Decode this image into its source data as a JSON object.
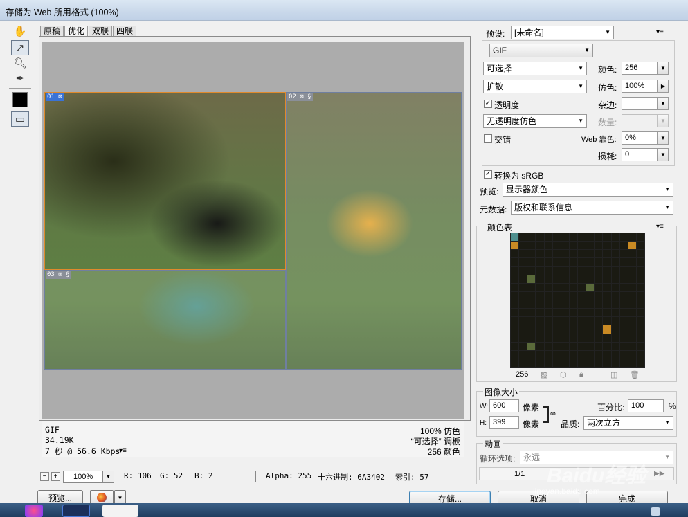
{
  "window": {
    "title": "存储为 Web 所用格式 (100%)"
  },
  "tabs": [
    {
      "label": "原稿"
    },
    {
      "label": "优化"
    },
    {
      "label": "双联"
    },
    {
      "label": "四联"
    }
  ],
  "slices": [
    {
      "label": "01"
    },
    {
      "label": "02"
    },
    {
      "label": "03"
    }
  ],
  "info": {
    "format": "GIF",
    "size": "34.19K",
    "time": "7 秒 @ 56.6 Kbps",
    "dither": "100% 仿色",
    "palette": "“可选择” 调板",
    "colors": "256 颜色"
  },
  "status": {
    "zoom": "100%",
    "r": "R: 106",
    "g": "G: 52",
    "b": "B: 2",
    "alpha": "Alpha: 255",
    "hex": "十六进制: 6A3402",
    "index": "索引: 57"
  },
  "buttons": {
    "preview": "预览...",
    "save": "存储...",
    "cancel": "取消",
    "done": "完成"
  },
  "settings": {
    "preset_label": "预设:",
    "preset_value": "[未命名]",
    "format": "GIF",
    "reduction": "可选择",
    "dither_algo": "扩散",
    "colors_label": "颜色:",
    "colors_value": "256",
    "dither_label": "仿色:",
    "dither_value": "100%",
    "transparency_label": "透明度",
    "transparency_checked": true,
    "matte_label": "杂边:",
    "trans_dither": "无透明度仿色",
    "amount_label": "数量:",
    "interlaced_label": "交错",
    "interlaced_checked": false,
    "web_snap_label": "Web 靠色:",
    "web_snap_value": "0%",
    "lossy_label": "损耗:",
    "lossy_value": "0",
    "convert_srgb_label": "转换为 sRGB",
    "convert_srgb_checked": true,
    "preview_label": "预览:",
    "preview_value": "显示器颜色",
    "metadata_label": "元数据:",
    "metadata_value": "版权和联系信息"
  },
  "color_table": {
    "title": "颜色表",
    "count": "256"
  },
  "image_size": {
    "title": "图像大小",
    "w_label": "W:",
    "w_value": "600",
    "h_label": "H:",
    "h_value": "399",
    "unit": "像素",
    "percent_label": "百分比:",
    "percent_value": "100",
    "percent_unit": "%",
    "quality_label": "品质:",
    "quality_value": "两次立方"
  },
  "animation": {
    "title": "动画",
    "loop_label": "循环选项:",
    "loop_value": "永远",
    "frame": "1/1"
  },
  "watermark": {
    "text": "Baidu经验",
    "url": "jingyan.baidu.com"
  }
}
